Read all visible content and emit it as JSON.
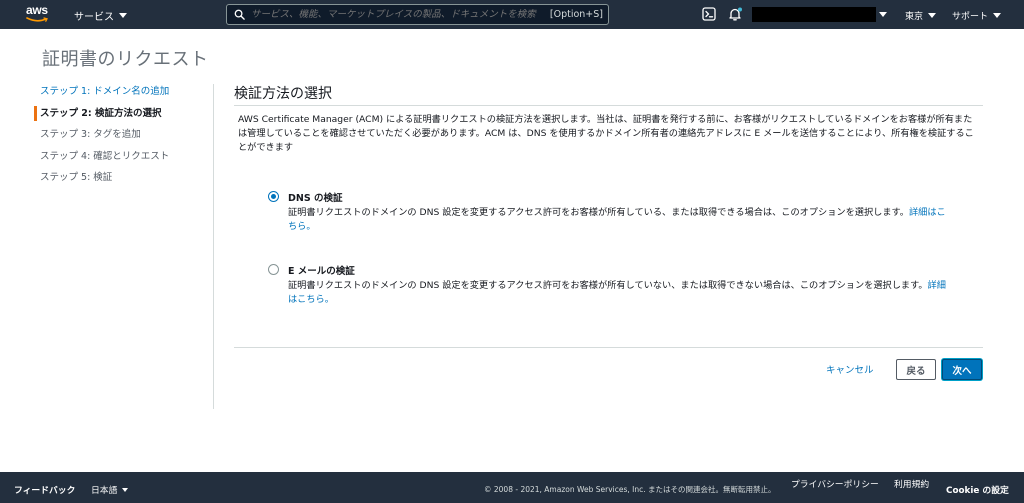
{
  "nav": {
    "logo_text": "aws",
    "services_label": "サービス",
    "search_placeholder": "サービス、機能、マーケットプレイスの製品、ドキュメントを検索",
    "search_shortcut": "[Option+S]",
    "region_label": "東京",
    "support_label": "サポート"
  },
  "page": {
    "title": "証明書のリクエスト"
  },
  "steps": [
    {
      "label": "ステップ 1: ドメイン名の追加"
    },
    {
      "label": "ステップ 2: 検証方法の選択"
    },
    {
      "label": "ステップ 3: タグを追加"
    },
    {
      "label": "ステップ 4: 確認とリクエスト"
    },
    {
      "label": "ステップ 5: 検証"
    }
  ],
  "main": {
    "section_title": "検証方法の選択",
    "description": "AWS Certificate Manager (ACM) による証明書リクエストの検証方法を選択します。当社は、証明書を発行する前に、お客様がリクエストしているドメインをお客様が所有または管理していることを確認させていただく必要があります。ACM は、DNS を使用するかドメイン所有者の連絡先アドレスに E メールを送信することにより、所有権を検証することができます",
    "options": [
      {
        "title": "DNS の検証",
        "desc": "証明書リクエストのドメインの DNS 設定を変更するアクセス許可をお客様が所有している、または取得できる場合は、このオプションを選択します。",
        "link": "詳細はこちら。",
        "checked": true
      },
      {
        "title": "E メールの検証",
        "desc": "証明書リクエストのドメインの DNS 設定を変更するアクセス許可をお客様が所有していない、または取得できない場合は、このオプションを選択します。",
        "link": "詳細はこちら。",
        "checked": false
      }
    ],
    "cancel_label": "キャンセル",
    "back_label": "戻る",
    "next_label": "次へ"
  },
  "footer": {
    "feedback": "フィードバック",
    "language": "日本語",
    "copyright": "© 2008 - 2021, Amazon Web Services, Inc. またはその関連会社。無断転用禁止。",
    "privacy": "プライバシーポリシー",
    "terms": "利用規約",
    "cookie": "Cookie の設定"
  },
  "colors": {
    "nav_bg": "#232f3e",
    "link": "#0073bb",
    "accent": "#ec7211"
  }
}
